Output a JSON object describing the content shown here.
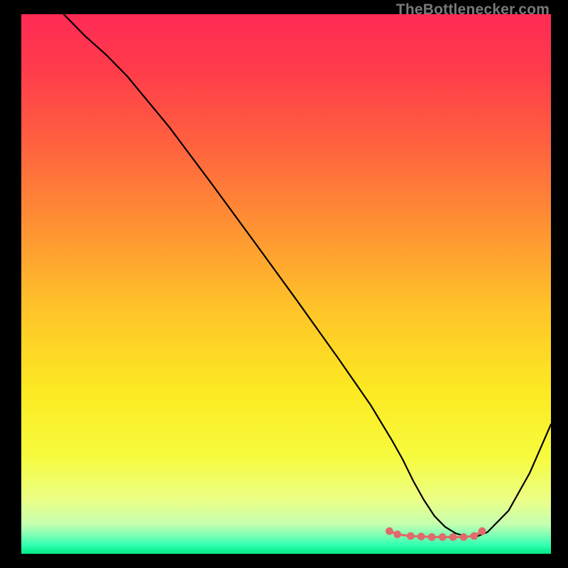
{
  "watermark": "TheBottlenecker.com",
  "chart_data": {
    "type": "line",
    "title": "",
    "xlabel": "",
    "ylabel": "",
    "xlim": [
      0,
      100
    ],
    "ylim": [
      0,
      100
    ],
    "background_gradient": {
      "stops": [
        {
          "offset": 0.0,
          "color": "#ff2a55"
        },
        {
          "offset": 0.1,
          "color": "#ff3b4b"
        },
        {
          "offset": 0.25,
          "color": "#ff643e"
        },
        {
          "offset": 0.4,
          "color": "#ff9433"
        },
        {
          "offset": 0.55,
          "color": "#ffc529"
        },
        {
          "offset": 0.7,
          "color": "#fcea22"
        },
        {
          "offset": 0.82,
          "color": "#f7fb3e"
        },
        {
          "offset": 0.9,
          "color": "#ebff86"
        },
        {
          "offset": 0.945,
          "color": "#c6ffb0"
        },
        {
          "offset": 0.965,
          "color": "#7fffb4"
        },
        {
          "offset": 0.985,
          "color": "#2dffb0"
        },
        {
          "offset": 1.0,
          "color": "#00e884"
        }
      ]
    },
    "series": [
      {
        "name": "bottleneck-curve",
        "color": "#000000",
        "width": 2.2,
        "x": [
          8,
          12,
          16,
          20,
          28,
          36,
          44,
          52,
          60,
          66,
          70,
          72,
          74,
          76,
          78,
          80,
          82,
          84,
          86,
          88,
          92,
          96,
          100
        ],
        "y": [
          100,
          96,
          92.5,
          88.5,
          79,
          68.5,
          57.8,
          47,
          36,
          27.5,
          21,
          17.5,
          13.5,
          10,
          7,
          5,
          3.8,
          3.2,
          3.2,
          4,
          8,
          15,
          24
        ]
      }
    ],
    "markers": {
      "name": "optimum-band",
      "color": "#e16a6a",
      "radius": 5.4,
      "line_width": 3.2,
      "x": [
        69.5,
        71,
        73.5,
        75.5,
        77.5,
        79.5,
        81.5,
        83.5,
        85.5,
        87
      ],
      "y": [
        4.2,
        3.6,
        3.3,
        3.2,
        3.1,
        3.1,
        3.1,
        3.1,
        3.3,
        4.2
      ]
    }
  }
}
